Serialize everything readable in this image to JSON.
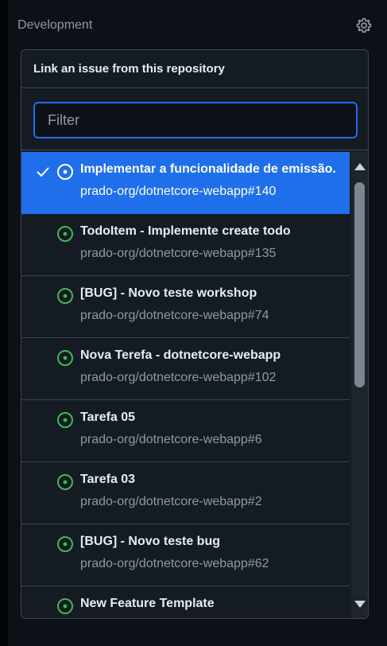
{
  "development": {
    "title": "Development",
    "settings_icon": "gear-icon"
  },
  "panel": {
    "header": "Link an issue from this repository",
    "filter": {
      "placeholder": "Filter",
      "value": ""
    },
    "items": [
      {
        "title": "Implementar a funcionalidade de emissão.",
        "repo": "prado-org/dotnetcore-webapp#140",
        "selected": true
      },
      {
        "title": "TodoItem - Implemente create todo",
        "repo": "prado-org/dotnetcore-webapp#135",
        "selected": false
      },
      {
        "title": "[BUG] - Novo teste workshop",
        "repo": "prado-org/dotnetcore-webapp#74",
        "selected": false
      },
      {
        "title": "Nova Terefa - dotnetcore-webapp",
        "repo": "prado-org/dotnetcore-webapp#102",
        "selected": false
      },
      {
        "title": "Tarefa 05",
        "repo": "prado-org/dotnetcore-webapp#6",
        "selected": false
      },
      {
        "title": "Tarefa 03",
        "repo": "prado-org/dotnetcore-webapp#2",
        "selected": false
      },
      {
        "title": "[BUG] - Novo teste bug",
        "repo": "prado-org/dotnetcore-webapp#62",
        "selected": false
      },
      {
        "title": "New Feature Template",
        "repo": "",
        "selected": false
      }
    ]
  },
  "colors": {
    "accent": "#1f6feb",
    "issue_open": "#3fb950",
    "background": "#0d1117",
    "panel": "#151b23",
    "border": "#3d444d",
    "muted_text": "#9198a1"
  }
}
